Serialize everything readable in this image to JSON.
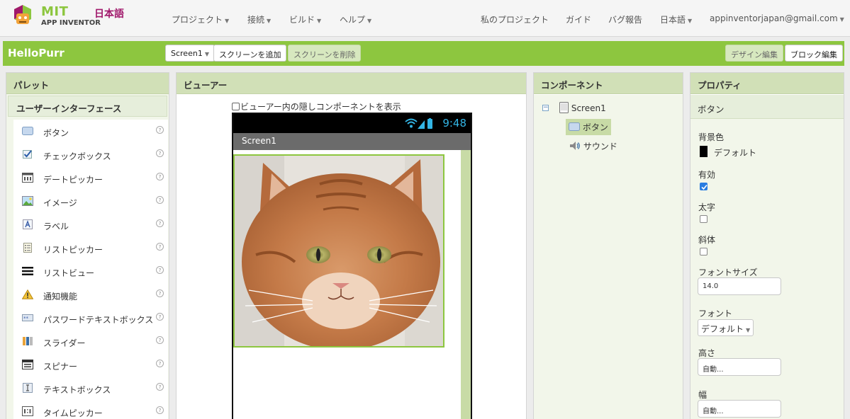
{
  "brand": {
    "mit": "MIT",
    "app_inventor": "APP INVENTOR",
    "language_badge": "日本語"
  },
  "topnav": {
    "left": [
      {
        "label": "プロジェクト"
      },
      {
        "label": "接続"
      },
      {
        "label": "ビルド"
      },
      {
        "label": "ヘルプ"
      }
    ],
    "my_projects": "私のプロジェクト",
    "guide": "ガイド",
    "bug_report": "バグ報告",
    "language": "日本語",
    "account": "appinventorjapan@gmail.com"
  },
  "toolbar": {
    "project_name": "HelloPurr",
    "screen_select": "Screen1",
    "add_screen": "スクリーンを追加",
    "remove_screen": "スクリーンを削除",
    "designer": "デザイン編集",
    "blocks": "ブロック編集"
  },
  "palette": {
    "title": "パレット",
    "category": "ユーザーインターフェース",
    "help_glyph": "?",
    "items": [
      {
        "label": "ボタン",
        "icon": "button-icon"
      },
      {
        "label": "チェックボックス",
        "icon": "checkbox-icon"
      },
      {
        "label": "デートピッカー",
        "icon": "datepicker-icon"
      },
      {
        "label": "イメージ",
        "icon": "image-icon"
      },
      {
        "label": "ラベル",
        "icon": "label-icon"
      },
      {
        "label": "リストピッカー",
        "icon": "listpicker-icon"
      },
      {
        "label": "リストビュー",
        "icon": "listview-icon"
      },
      {
        "label": "通知機能",
        "icon": "notifier-icon"
      },
      {
        "label": "パスワードテキストボックス",
        "icon": "password-icon"
      },
      {
        "label": "スライダー",
        "icon": "slider-icon"
      },
      {
        "label": "スピナー",
        "icon": "spinner-icon"
      },
      {
        "label": "テキストボックス",
        "icon": "textbox-icon"
      },
      {
        "label": "タイムピッカー",
        "icon": "timepicker-icon"
      }
    ]
  },
  "viewer": {
    "title": "ビューアー",
    "show_hidden_label": "ビューアー内の隠しコンポーネントを表示",
    "phone_time": "9:48",
    "screen_title": "Screen1"
  },
  "components": {
    "title": "コンポーネント",
    "tree": {
      "root": "Screen1",
      "children": [
        {
          "label": "ボタン",
          "selected": true
        },
        {
          "label": "サウンド",
          "selected": false
        }
      ]
    }
  },
  "properties": {
    "title": "プロパティ",
    "component": "ボタン",
    "bg_color_label": "背景色",
    "bg_color_value": "デフォルト",
    "enabled_label": "有効",
    "enabled": true,
    "bold_label": "太字",
    "bold": false,
    "italic_label": "斜体",
    "italic": false,
    "font_size_label": "フォントサイズ",
    "font_size_value": "14.0",
    "font_label": "フォント",
    "font_value": "デフォルト",
    "height_label": "高さ",
    "height_value": "自動...",
    "width_label": "幅",
    "width_value": "自動..."
  },
  "colors": {
    "accent_green": "#8dc63f",
    "panel_header": "#d1e0b7",
    "brand_magenta": "#a0186b",
    "status_blue": "#33b5e5"
  }
}
